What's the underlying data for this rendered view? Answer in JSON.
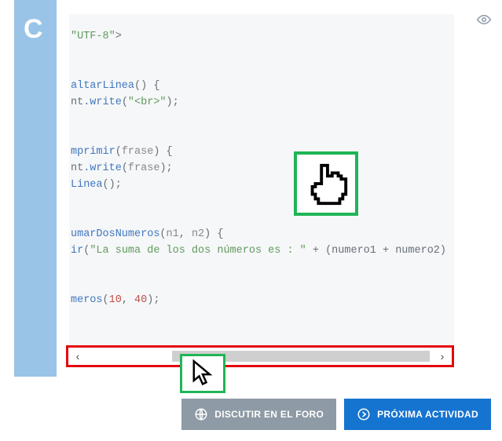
{
  "sidebar": {
    "letter": "C"
  },
  "code": {
    "l1_pre": "\"UTF-8\"",
    "l1_post": ">",
    "l4_fn": "altarLinea",
    "l4_sig": "() {",
    "l5_obj": "nt",
    "l5_dotfn": ".write",
    "l5_args_open": "(",
    "l5_str": "\"<br>\"",
    "l5_close": ");",
    "l8_fn": "mprimir",
    "l8_sig_open": "(",
    "l8_param": "frase",
    "l8_sig_close": ") {",
    "l9_obj": "nt",
    "l9_dotfn": ".write",
    "l9_args_open": "(",
    "l9_arg": "frase",
    "l9_close": ");",
    "l10_fn": "Linea",
    "l10_call": "();",
    "l13_fn": "umarDosNumeros",
    "l13_sig_open": "(",
    "l13_p1": "n1",
    "l13_comma": ", ",
    "l13_p2": "n2",
    "l13_sig_close": ") {",
    "l14_fn": "ir",
    "l14_open": "(",
    "l14_str": "\"La suma de los dos números es : \"",
    "l14_plus1": " + (",
    "l14_id1": "numero1",
    "l14_plus2": " + ",
    "l14_id2": "numero2",
    "l14_close": ") )",
    "l17_fn": "meros",
    "l17_open": "(",
    "l17_n1": "10",
    "l17_comma": ", ",
    "l17_n2": "40",
    "l17_close": ");"
  },
  "buttons": {
    "forum": "DISCUTIR EN EL FORO",
    "next": "PRÓXIMA ACTIVIDAD"
  }
}
